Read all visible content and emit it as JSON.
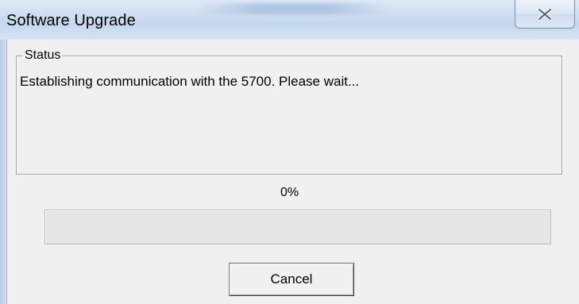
{
  "window": {
    "title": "Software Upgrade"
  },
  "icons": {
    "close": "close-icon"
  },
  "status": {
    "legend": "Status",
    "message": "Establishing communication with the 5700. Please wait..."
  },
  "progress": {
    "label": "0%",
    "value": 0
  },
  "buttons": {
    "cancel_label": "Cancel"
  },
  "colors": {
    "progress_fill": "#06b025",
    "title_bar": "#cfdff0"
  }
}
